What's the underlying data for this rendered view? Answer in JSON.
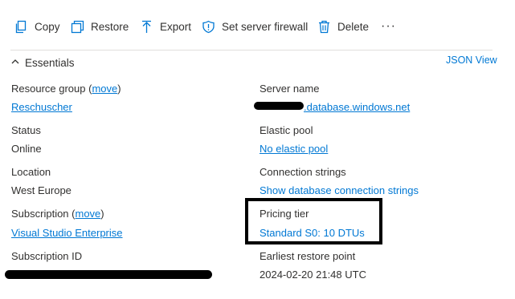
{
  "toolbar": {
    "copy": "Copy",
    "restore": "Restore",
    "export": "Export",
    "firewall": "Set server firewall",
    "delete": "Delete",
    "more": "···"
  },
  "essentials": {
    "title": "Essentials",
    "json_view": "JSON View"
  },
  "left": {
    "resource_group": {
      "label": "Resource group",
      "paren_open": " (",
      "move": "move",
      "paren_close": ")",
      "value": "Reschuscher"
    },
    "status": {
      "label": "Status",
      "value": "Online"
    },
    "location": {
      "label": "Location",
      "value": "West Europe"
    },
    "subscription": {
      "label": "Subscription",
      "paren_open": " (",
      "move": "move",
      "paren_close": ")",
      "value": "Visual Studio Enterprise"
    },
    "subscription_id": {
      "label": "Subscription ID"
    }
  },
  "right": {
    "server_name": {
      "label": "Server name",
      "value": ".database.windows.net"
    },
    "elastic_pool": {
      "label": "Elastic pool",
      "value": "No elastic pool"
    },
    "connection_strings": {
      "label": "Connection strings",
      "value": "Show database connection strings"
    },
    "pricing_tier": {
      "label": "Pricing tier",
      "value": "Standard S0: 10 DTUs"
    },
    "restore_point": {
      "label": "Earliest restore point",
      "value": "2024-02-20 21:48 UTC"
    }
  }
}
